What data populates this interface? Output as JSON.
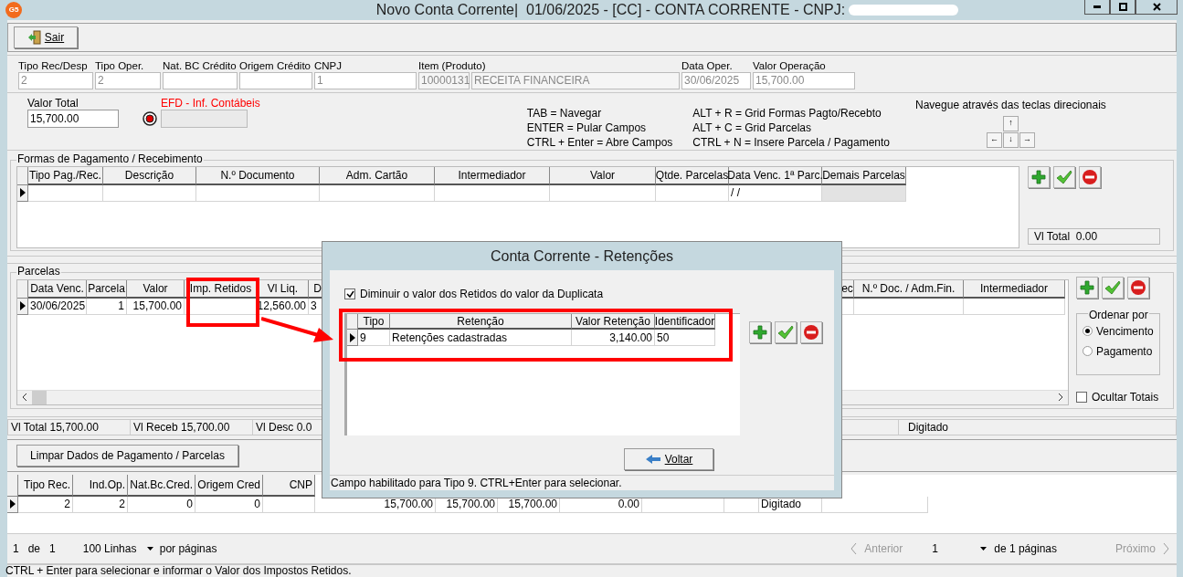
{
  "window": {
    "app_badge": "G5",
    "title": "Novo Conta Corrente|  01/06/2025 - [CC] - CONTA CORRENTE - CNPJ:"
  },
  "toolbar": {
    "exit_button": "Sair"
  },
  "fields": [
    {
      "label": "Tipo Rec/Desp",
      "value": "2",
      "disabled": true
    },
    {
      "label": "Tipo Oper.",
      "value": "2",
      "disabled": true
    },
    {
      "label": "Nat. BC Crédito"
    },
    {
      "label": "Origem Crédito"
    },
    {
      "label": "CNPJ",
      "value": "1",
      "disabled": true
    },
    {
      "label": "Item (Produto)",
      "value": "10000131",
      "value2": "RECEITA FINANCEIRA",
      "disabled": true
    },
    {
      "label": "Data Oper.",
      "value": "30/06/2025",
      "disabled": true
    },
    {
      "label": "Valor Operação",
      "value": "15,700.00",
      "disabled": true
    }
  ],
  "valor_total": {
    "label": "Valor Total",
    "value": "15,700.00",
    "efd_label": "EFD - Inf. Contábeis"
  },
  "shortcuts": [
    [
      "TAB = Navegar",
      "ENTER = Pular Campos",
      "CTRL + Enter = Abre Campos"
    ],
    [
      "ALT + R = Grid Formas Pagto/Recebto",
      "ALT + C = Grid Parcelas",
      "CTRL + N = Insere Parcela / Pagamento"
    ]
  ],
  "navigation": {
    "caption": "Navegue através das teclas direcionais",
    "keys": [
      "↑",
      "←",
      "↓",
      "→"
    ]
  },
  "formas": {
    "title": "Formas de Pagamento / Recebimento",
    "columns": [
      "Tipo Pag./Rec.",
      "Descrição",
      "N.º Documento",
      "Adm. Cartão",
      "Intermediador",
      "Valor",
      "Qtde. Parcelas",
      "Data Venc. 1ª Parc.",
      "Demais Parcelas"
    ],
    "rows": [
      {
        "current": true,
        "cells": [
          null,
          null,
          null,
          null,
          null,
          null,
          null,
          " / /",
          null
        ]
      }
    ],
    "total": "Vl Total  0.00"
  },
  "parcelas": {
    "title": "Parcelas",
    "columns": [
      "Data Venc.",
      "Parcela",
      "Valor",
      "Imp. Retidos",
      "Vl Liq.",
      "D",
      null,
      "ec",
      "N.º Doc. / Adm.Fin.",
      "Intermediador"
    ],
    "rows": [
      {
        "current": true,
        "cells": [
          "30/06/2025",
          "1",
          "15,700.00",
          null,
          "12,560.00",
          "3",
          null,
          null,
          null,
          null
        ]
      }
    ],
    "order_by": {
      "title": "Ordenar por",
      "options": [
        {
          "label": "Vencimento",
          "selected": true
        },
        {
          "label": "Pagamento",
          "selected": false
        }
      ]
    },
    "hide_totals": {
      "label": "Ocultar Totais",
      "checked": false
    }
  },
  "totals": [
    "Vl Total 15,700.00",
    "Vl Receb 15,700.00",
    "Vl Desc 0.0"
  ],
  "status_right": "Digitado",
  "clear_button": "Limpar Dados de Pagamento / Parcelas",
  "bottom_grid": {
    "columns": [
      "Tipo Rec.",
      "Ind.Op.",
      "Nat.Bc.Cred.",
      "Origem Cred",
      "CNP"
    ],
    "rows": [
      {
        "current": true,
        "cells": [
          "2",
          "2",
          "0",
          "0",
          null,
          "15,700.00",
          "15,700.00",
          "15,700.00",
          "0.00",
          null,
          null,
          "Digitado"
        ]
      }
    ]
  },
  "pagination": {
    "page": "1",
    "of_label": "de",
    "pages": "1",
    "rows": "100 Linhas",
    "per_page": "por páginas",
    "prev": "Anterior",
    "current": "1",
    "total": "de 1 páginas",
    "next": "Próximo"
  },
  "status_bar": "CTRL + Enter para selecionar e informar o Valor dos Impostos Retidos.",
  "dialog": {
    "title": "Conta Corrente - Retenções",
    "checkbox": {
      "label": "Diminuir o valor dos Retidos do valor da Duplicata",
      "checked": true
    },
    "columns": [
      "Tipo",
      "Retenção",
      "Valor Retenção",
      "Identificador"
    ],
    "rows": [
      {
        "current": true,
        "cells": [
          "9",
          "Retenções cadastradas",
          "3,140.00",
          "50"
        ]
      }
    ],
    "back_button": "Voltar",
    "status": "Campo habilitado para Tipo 9. CTRL+Enter para selecionar."
  }
}
